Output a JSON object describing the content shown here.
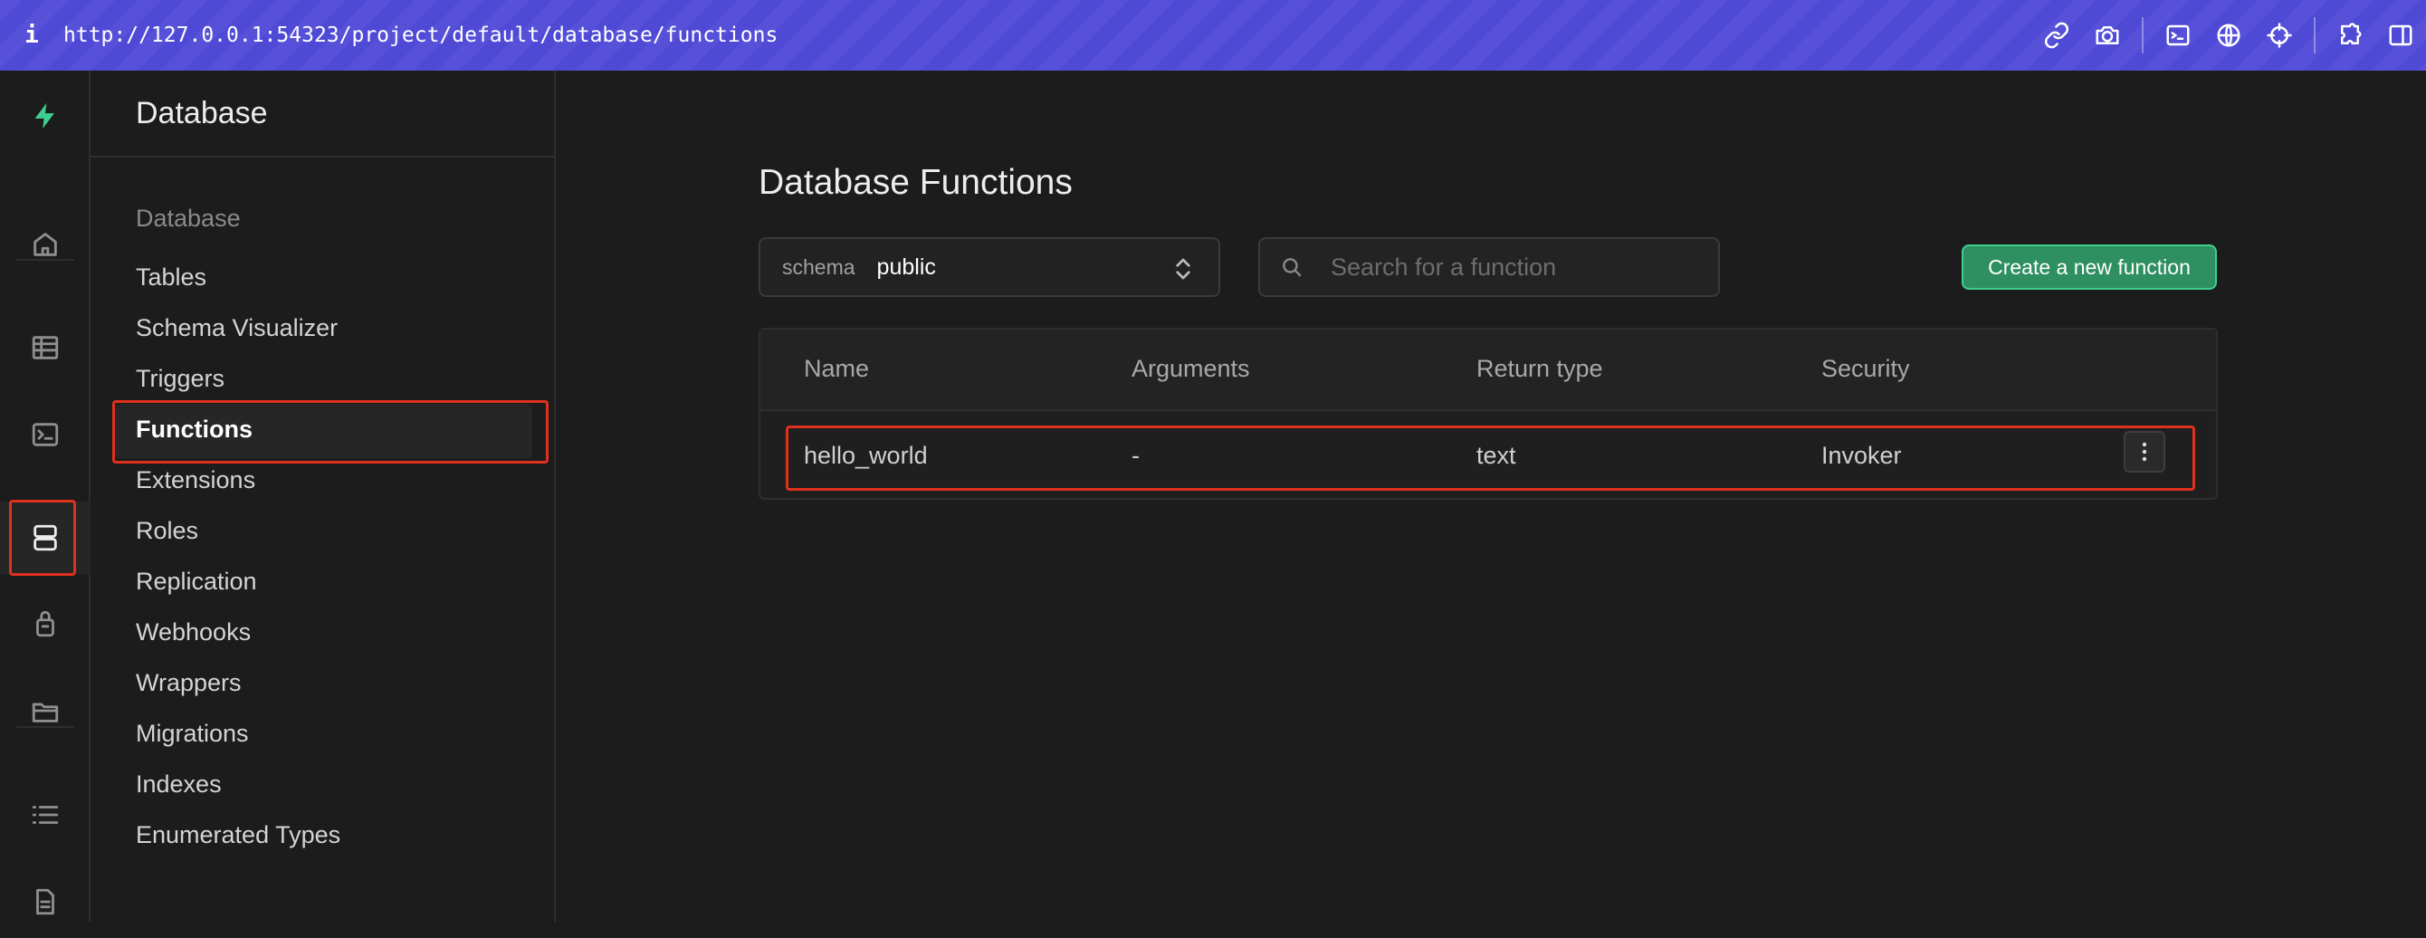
{
  "browser": {
    "info_icon": "i",
    "url": "http://127.0.0.1:54323/project/default/database/functions",
    "icons": [
      "link-icon",
      "camera-icon",
      "terminal-icon",
      "globe-icon",
      "crosshair-icon",
      "puzzle-icon",
      "sidebar-icon"
    ]
  },
  "rail": {
    "items": [
      "logo-icon",
      "home-icon",
      "table-editor-icon",
      "sql-editor-icon",
      "database-icon",
      "auth-icon",
      "storage-icon",
      "logs-icon",
      "docs-icon"
    ],
    "active": "database-icon"
  },
  "sidebar": {
    "title": "Database",
    "section_label": "Database",
    "items": [
      {
        "label": "Tables"
      },
      {
        "label": "Schema Visualizer"
      },
      {
        "label": "Triggers"
      },
      {
        "label": "Functions"
      },
      {
        "label": "Extensions"
      },
      {
        "label": "Roles"
      },
      {
        "label": "Replication"
      },
      {
        "label": "Webhooks"
      },
      {
        "label": "Wrappers"
      },
      {
        "label": "Migrations"
      },
      {
        "label": "Indexes"
      },
      {
        "label": "Enumerated Types"
      }
    ],
    "active_item": "Functions"
  },
  "main": {
    "title": "Database Functions",
    "schema_label": "schema",
    "schema_value": "public",
    "search_placeholder": "Search for a function",
    "create_button": "Create a new function",
    "columns": [
      "Name",
      "Arguments",
      "Return type",
      "Security"
    ],
    "rows": [
      {
        "name": "hello_world",
        "arguments": "-",
        "return_type": "text",
        "security": "Invoker"
      }
    ]
  },
  "colors": {
    "browser_bar": "#4f4ad6",
    "accent_green": "#3ecf8e",
    "highlight_red": "#e0301e",
    "background": "#1c1c1c"
  }
}
